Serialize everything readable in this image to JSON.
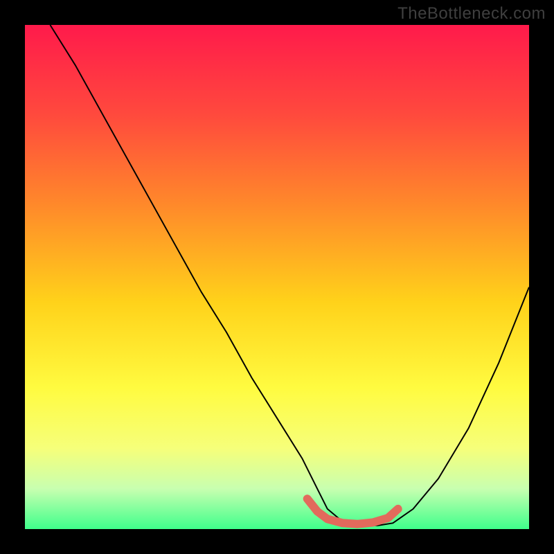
{
  "watermark": "TheBottleneck.com",
  "chart_data": {
    "type": "line",
    "title": "",
    "xlabel": "",
    "ylabel": "",
    "xlim": [
      0,
      100
    ],
    "ylim": [
      0,
      100
    ],
    "series": [
      {
        "name": "bottleneck-curve",
        "x": [
          5,
          10,
          15,
          20,
          25,
          30,
          35,
          40,
          45,
          50,
          55,
          58,
          60,
          63,
          66,
          70,
          73,
          77,
          82,
          88,
          94,
          100
        ],
        "values": [
          100,
          92,
          83,
          74,
          65,
          56,
          47,
          39,
          30,
          22,
          14,
          8,
          4,
          1.5,
          0.8,
          0.7,
          1.2,
          4,
          10,
          20,
          33,
          48
        ]
      },
      {
        "name": "highlight-band",
        "x": [
          56,
          58,
          60,
          63,
          66,
          69,
          72,
          74
        ],
        "values": [
          6,
          3.5,
          2,
          1.2,
          1,
          1.3,
          2.2,
          4
        ]
      }
    ],
    "colors": {
      "curve": "#000000",
      "highlight": "#e26a5c",
      "gradient_top": "#ff1a4b",
      "gradient_bottom": "#3fff8b"
    }
  }
}
